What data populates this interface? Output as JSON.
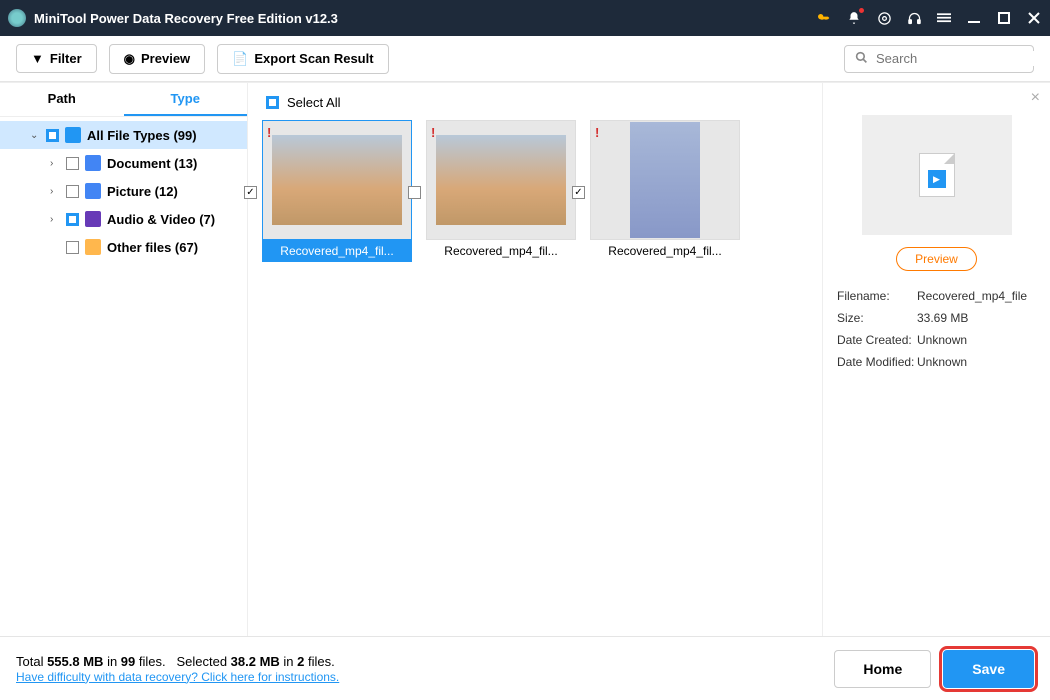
{
  "titlebar": {
    "title": "MiniTool Power Data Recovery Free Edition v12.3"
  },
  "toolbar": {
    "filter": "Filter",
    "preview": "Preview",
    "export": "Export Scan Result",
    "search_placeholder": "Search"
  },
  "sidebar": {
    "tabs": {
      "path": "Path",
      "type": "Type"
    },
    "items": [
      {
        "label": "All File Types (99)"
      },
      {
        "label": "Document (13)"
      },
      {
        "label": "Picture (12)"
      },
      {
        "label": "Audio & Video (7)"
      },
      {
        "label": "Other files (67)"
      }
    ]
  },
  "content": {
    "select_all": "Select All",
    "files": [
      {
        "name": "Recovered_mp4_fil..."
      },
      {
        "name": "Recovered_mp4_fil..."
      },
      {
        "name": "Recovered_mp4_fil..."
      }
    ]
  },
  "details": {
    "preview_btn": "Preview",
    "meta": {
      "filename_k": "Filename:",
      "filename_v": "Recovered_mp4_file",
      "size_k": "Size:",
      "size_v": "33.69 MB",
      "created_k": "Date Created:",
      "created_v": "Unknown",
      "modified_k": "Date Modified:",
      "modified_v": "Unknown"
    }
  },
  "footer": {
    "total_pre": "Total ",
    "total_size": "555.8 MB",
    "total_mid": " in ",
    "total_files": "99",
    "total_post": " files.",
    "sel_pre": "Selected ",
    "sel_size": "38.2 MB",
    "sel_mid": " in ",
    "sel_files": "2",
    "sel_post": " files.",
    "help": "Have difficulty with data recovery? Click here for instructions.",
    "home": "Home",
    "save": "Save"
  }
}
